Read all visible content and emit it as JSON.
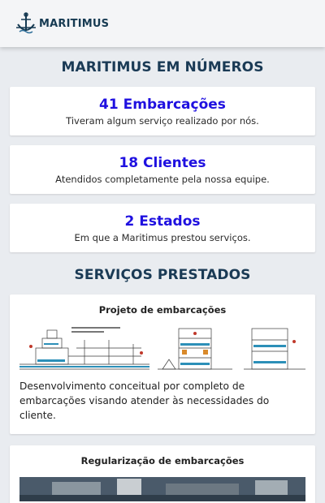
{
  "brand": {
    "name": "MARITIMUS",
    "logo_icon": "ship-wheel-anchor-icon"
  },
  "numbers_section": {
    "title": "MARITIMUS EM NÚMEROS"
  },
  "stats": [
    {
      "value": "41 Embarcações",
      "description": "Tiveram algum serviço realizado por nós."
    },
    {
      "value": "18 Clientes",
      "description": "Atendidos completamente pela nossa equipe."
    },
    {
      "value": "2 Estados",
      "description": "Em que a Maritimus prestou serviços."
    }
  ],
  "services_section": {
    "title": "SERVIÇOS PRESTADOS"
  },
  "services": [
    {
      "title": "Projeto de embarcações",
      "image": "vessel-blueprint-drawing",
      "description": "Desenvolvimento conceitual por completo de embarcações visando atender às necessidades do cliente."
    },
    {
      "title": "Regularização de embarcações",
      "image": "vessel-photo"
    }
  ],
  "colors": {
    "accent": "#1f10e0",
    "heading": "#1a3a55",
    "background": "#e9ecf0"
  }
}
